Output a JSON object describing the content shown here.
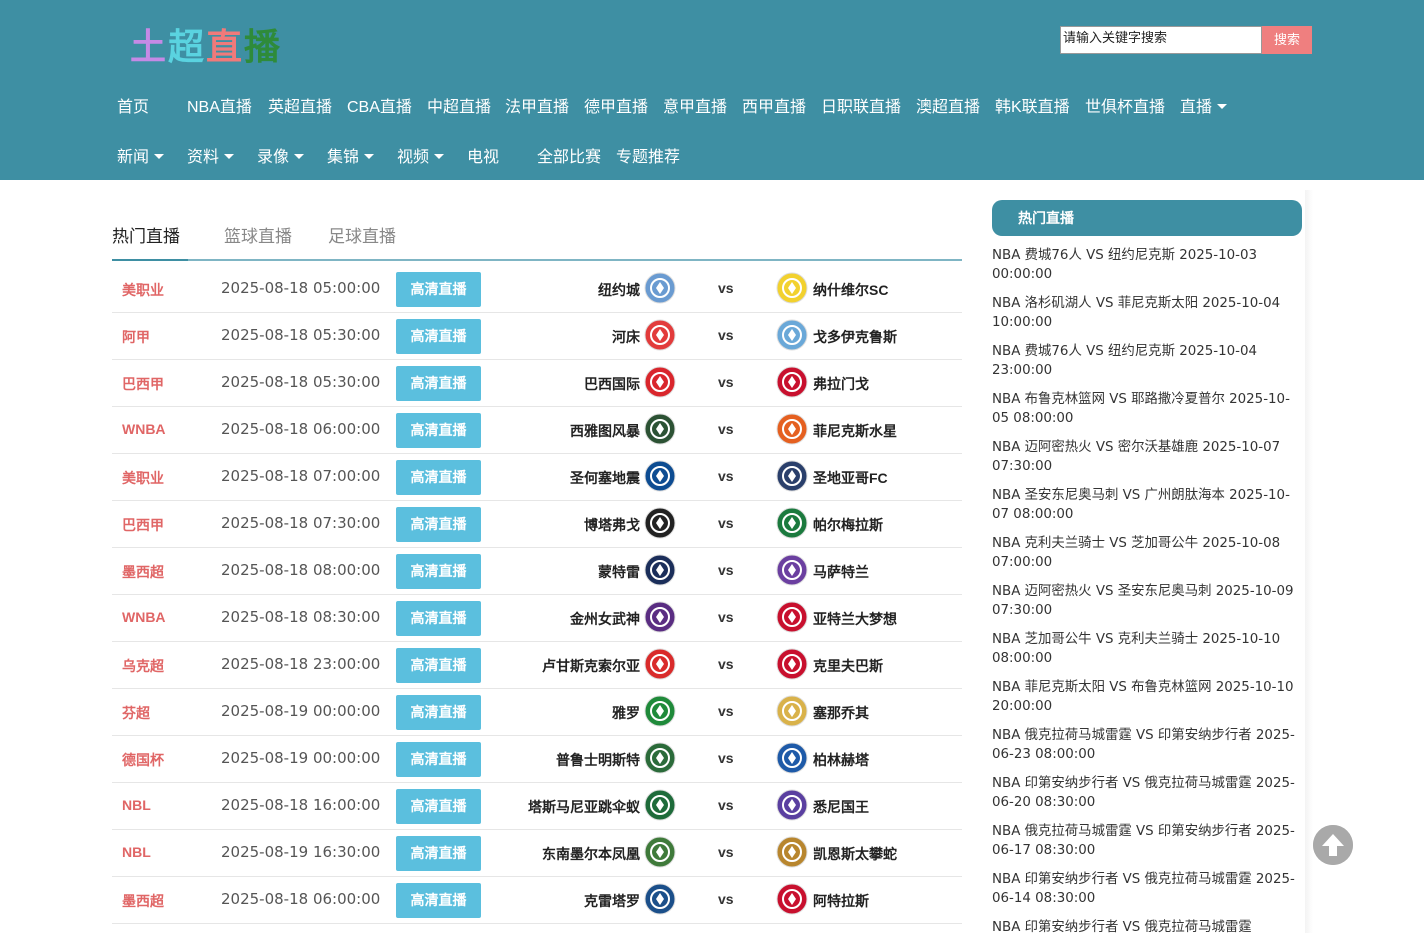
{
  "brand": {
    "logo_chars": [
      {
        "char": "土",
        "color": "#c58ae6"
      },
      {
        "char": "超",
        "color": "#5ad3e0"
      },
      {
        "char": "直",
        "color": "#f07a7a"
      },
      {
        "char": "播",
        "color": "#2e8b3a"
      }
    ]
  },
  "search": {
    "value": "请输入关键字搜索",
    "button_label": "搜索"
  },
  "nav": {
    "row1": [
      {
        "label": "首页",
        "dropdown": false
      },
      {
        "label": "NBA直播",
        "dropdown": false
      },
      {
        "label": "英超直播",
        "dropdown": false
      },
      {
        "label": "CBA直播",
        "dropdown": false
      },
      {
        "label": "中超直播",
        "dropdown": false
      },
      {
        "label": "法甲直播",
        "dropdown": false
      },
      {
        "label": "德甲直播",
        "dropdown": false
      },
      {
        "label": "意甲直播",
        "dropdown": false
      },
      {
        "label": "西甲直播",
        "dropdown": false
      },
      {
        "label": "日职联直播",
        "dropdown": false
      },
      {
        "label": "澳超直播",
        "dropdown": false
      },
      {
        "label": "韩K联直播",
        "dropdown": false
      },
      {
        "label": "世俱杯直播",
        "dropdown": false
      },
      {
        "label": "直播",
        "dropdown": true
      }
    ],
    "row2": [
      {
        "label": "新闻",
        "dropdown": true
      },
      {
        "label": "资料",
        "dropdown": true
      },
      {
        "label": "录像",
        "dropdown": true
      },
      {
        "label": "集锦",
        "dropdown": true
      },
      {
        "label": "视频",
        "dropdown": true
      },
      {
        "label": "电视",
        "dropdown": false
      },
      {
        "label": "全部比赛",
        "dropdown": false
      },
      {
        "label": "专题推荐",
        "dropdown": false
      }
    ]
  },
  "tabs": [
    "热门直播",
    "篮球直播",
    "足球直播"
  ],
  "live_button_label": "高清直播",
  "vs_label": "vs",
  "matches": [
    {
      "league": "美职业",
      "time": "2025-08-18 05:00:00",
      "home": "纽约城",
      "away": "纳什维尔SC",
      "home_color": "#6a9bd1",
      "away_color": "#f2d12e"
    },
    {
      "league": "阿甲",
      "time": "2025-08-18 05:30:00",
      "home": "河床",
      "away": "戈多伊克鲁斯",
      "home_color": "#e23b3b",
      "away_color": "#6aa8d8"
    },
    {
      "league": "巴西甲",
      "time": "2025-08-18 05:30:00",
      "home": "巴西国际",
      "away": "弗拉门戈",
      "home_color": "#d9262c",
      "away_color": "#c8102e"
    },
    {
      "league": "WNBA",
      "time": "2025-08-18 06:00:00",
      "home": "西雅图风暴",
      "away": "菲尼克斯水星",
      "home_color": "#2c5234",
      "away_color": "#e56020"
    },
    {
      "league": "美职业",
      "time": "2025-08-18 07:00:00",
      "home": "圣何塞地震",
      "away": "圣地亚哥FC",
      "home_color": "#0d4c92",
      "away_color": "#2a3f6b"
    },
    {
      "league": "巴西甲",
      "time": "2025-08-18 07:30:00",
      "home": "博塔弗戈",
      "away": "帕尔梅拉斯",
      "home_color": "#222222",
      "away_color": "#1b7a3e"
    },
    {
      "league": "墨西超",
      "time": "2025-08-18 08:00:00",
      "home": "蒙特雷",
      "away": "马萨特兰",
      "home_color": "#1b2e5a",
      "away_color": "#6b3fa0"
    },
    {
      "league": "WNBA",
      "time": "2025-08-18 08:30:00",
      "home": "金州女武神",
      "away": "亚特兰大梦想",
      "home_color": "#5a2d82",
      "away_color": "#c8102e"
    },
    {
      "league": "乌克超",
      "time": "2025-08-18 23:00:00",
      "home": "卢甘斯克索尔亚",
      "away": "克里夫巴斯",
      "home_color": "#d92b2b",
      "away_color": "#c8102e"
    },
    {
      "league": "芬超",
      "time": "2025-08-19 00:00:00",
      "home": "雅罗",
      "away": "塞那乔其",
      "home_color": "#1f8a3a",
      "away_color": "#d9b24a"
    },
    {
      "league": "德国杯",
      "time": "2025-08-19 00:00:00",
      "home": "普鲁士明斯特",
      "away": "柏林赫塔",
      "home_color": "#2b6b3a",
      "away_color": "#1e5aa8"
    },
    {
      "league": "NBL",
      "time": "2025-08-18 16:00:00",
      "home": "塔斯马尼亚跳伞蚁",
      "away": "悉尼国王",
      "home_color": "#1e6b3a",
      "away_color": "#5a3fa0"
    },
    {
      "league": "NBL",
      "time": "2025-08-19 16:30:00",
      "home": "东南墨尔本凤凰",
      "away": "凯恩斯太攀蛇",
      "home_color": "#3f7a3a",
      "away_color": "#b8862e"
    },
    {
      "league": "墨西超",
      "time": "2025-08-18 06:00:00",
      "home": "克雷塔罗",
      "away": "阿特拉斯",
      "home_color": "#1b4f8a",
      "away_color": "#c8102e"
    }
  ],
  "sidebar": {
    "title": "热门直播",
    "items": [
      "NBA 费城76人 VS 纽约尼克斯 2025-10-03 00:00:00",
      "NBA 洛杉矶湖人 VS 菲尼克斯太阳 2025-10-04 10:00:00",
      "NBA 费城76人 VS 纽约尼克斯 2025-10-04 23:00:00",
      "NBA 布鲁克林篮网 VS 耶路撒冷夏普尔 2025-10-05 08:00:00",
      "NBA 迈阿密热火 VS 密尔沃基雄鹿 2025-10-07 07:30:00",
      "NBA 圣安东尼奥马刺 VS 广州朗肽海本 2025-10-07 08:00:00",
      "NBA 克利夫兰骑士 VS 芝加哥公牛 2025-10-08 07:00:00",
      "NBA 迈阿密热火 VS 圣安东尼奥马刺 2025-10-09 07:30:00",
      "NBA 芝加哥公牛 VS 克利夫兰骑士 2025-10-10 08:00:00",
      "NBA 菲尼克斯太阳 VS 布鲁克林篮网 2025-10-10 20:00:00",
      "NBA 俄克拉荷马城雷霆 VS 印第安纳步行者 2025-06-23 08:00:00",
      "NBA 印第安纳步行者 VS 俄克拉荷马城雷霆 2025-06-20 08:30:00",
      "NBA 俄克拉荷马城雷霆 VS 印第安纳步行者 2025-06-17 08:30:00",
      "NBA 印第安纳步行者 VS 俄克拉荷马城雷霆 2025-06-14 08:30:00",
      "NBA 印第安纳步行者 VS 俄克拉荷马城雷霆"
    ]
  },
  "colors": {
    "header_bg": "#3e8fa3",
    "search_button": "#ef7f7f",
    "live_button": "#5bbfde",
    "league_text": "#e06666"
  },
  "icons": {
    "back_to_top": "arrow-up-circle-icon",
    "dropdown": "caret-down-icon",
    "team_logo": "team-crest-icon"
  }
}
